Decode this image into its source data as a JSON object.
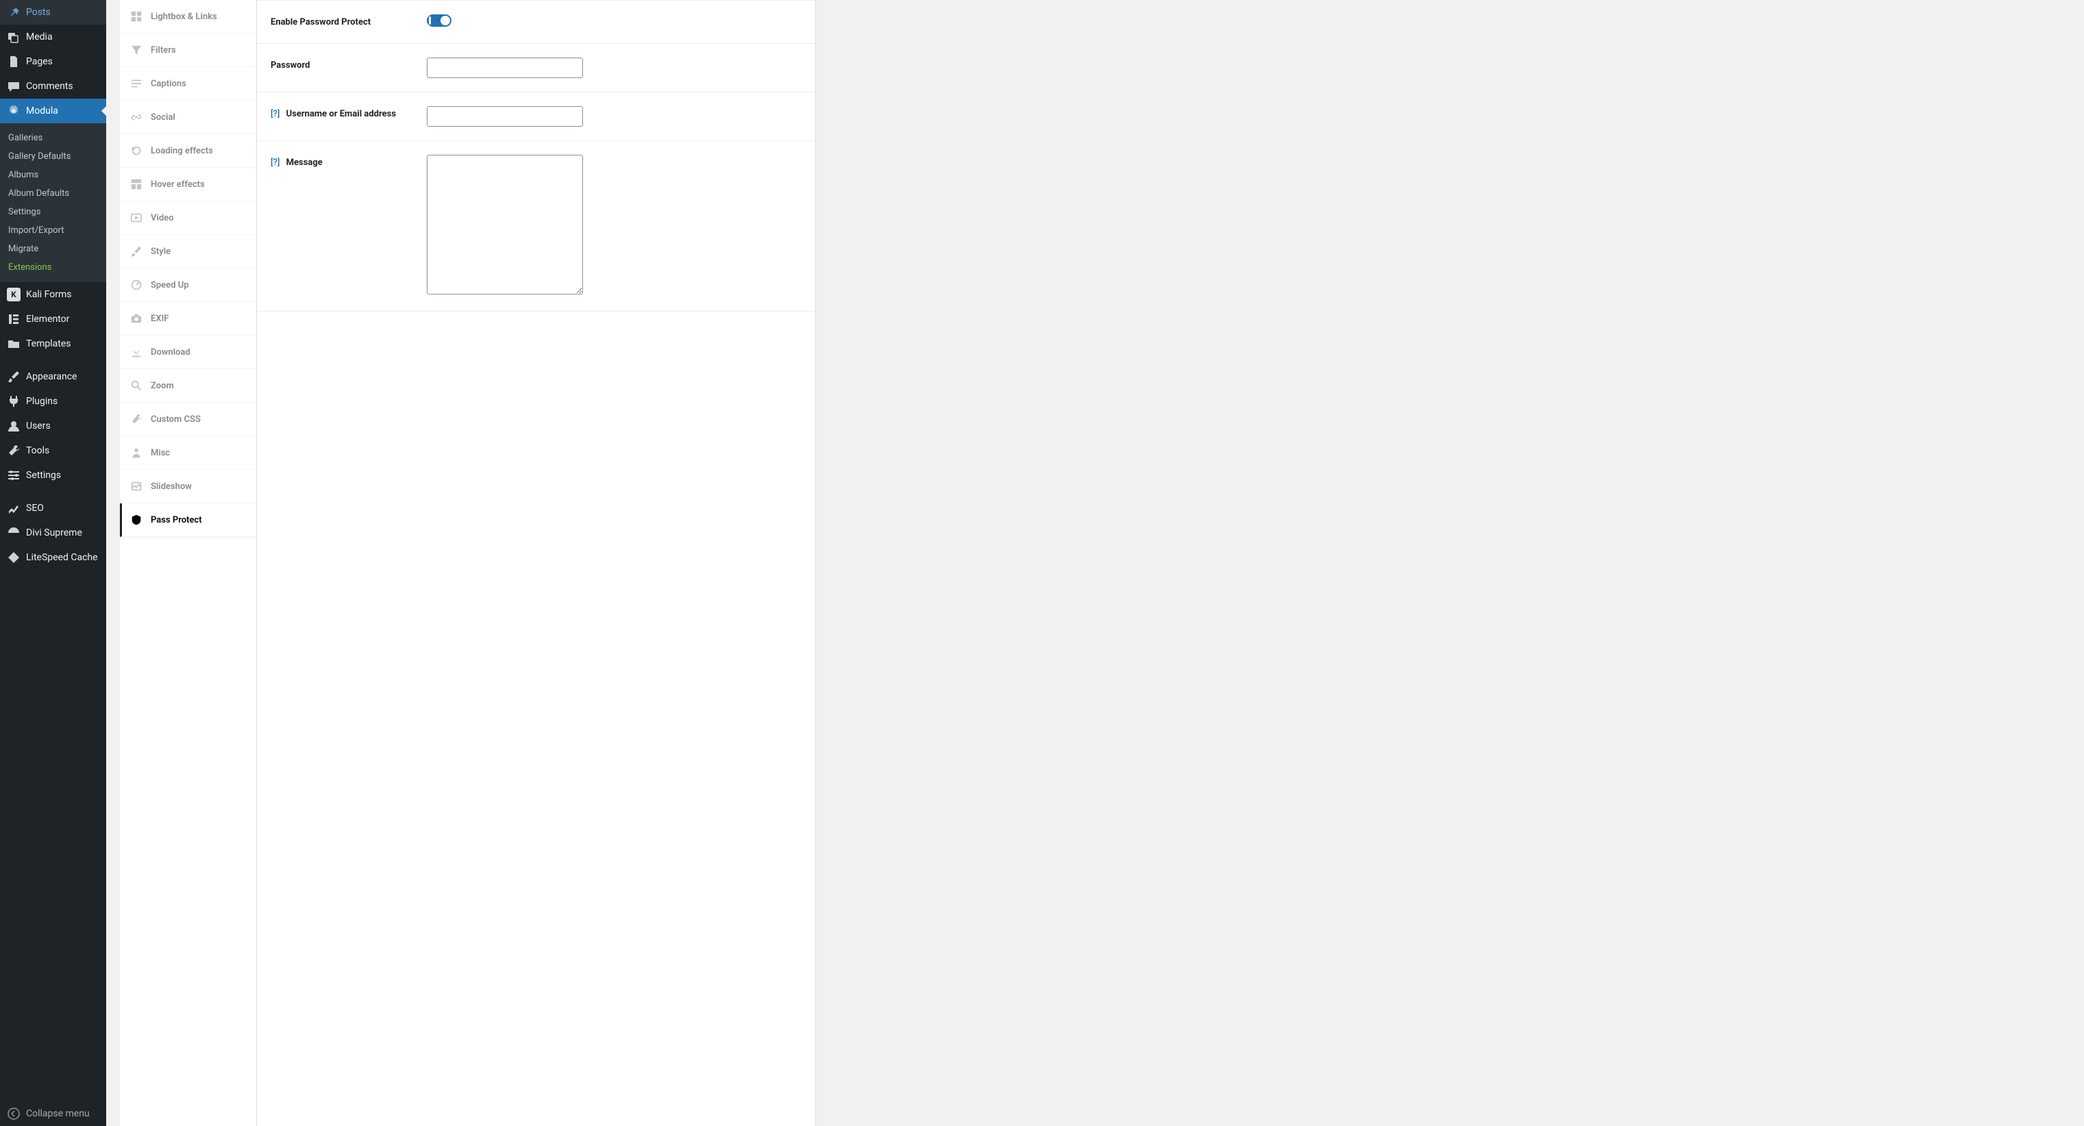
{
  "admin": {
    "items": [
      {
        "label": "Posts"
      },
      {
        "label": "Media"
      },
      {
        "label": "Pages"
      },
      {
        "label": "Comments"
      },
      {
        "label": "Modula"
      }
    ],
    "sub": [
      {
        "label": "Galleries"
      },
      {
        "label": "Gallery Defaults"
      },
      {
        "label": "Albums"
      },
      {
        "label": "Album Defaults"
      },
      {
        "label": "Settings"
      },
      {
        "label": "Import/Export"
      },
      {
        "label": "Migrate"
      },
      {
        "label": "Extensions"
      }
    ],
    "items2": [
      {
        "label": "Kali Forms"
      },
      {
        "label": "Elementor"
      },
      {
        "label": "Templates"
      },
      {
        "label": "Appearance"
      },
      {
        "label": "Plugins"
      },
      {
        "label": "Users"
      },
      {
        "label": "Tools"
      },
      {
        "label": "Settings"
      },
      {
        "label": "SEO"
      },
      {
        "label": "Divi Supreme"
      },
      {
        "label": "LiteSpeed Cache"
      }
    ],
    "collapse": "Collapse menu"
  },
  "tabs": [
    {
      "label": "Lightbox & Links"
    },
    {
      "label": "Filters"
    },
    {
      "label": "Captions"
    },
    {
      "label": "Social"
    },
    {
      "label": "Loading effects"
    },
    {
      "label": "Hover effects"
    },
    {
      "label": "Video"
    },
    {
      "label": "Style"
    },
    {
      "label": "Speed Up"
    },
    {
      "label": "EXIF"
    },
    {
      "label": "Download"
    },
    {
      "label": "Zoom"
    },
    {
      "label": "Custom CSS"
    },
    {
      "label": "Misc"
    },
    {
      "label": "Slideshow"
    },
    {
      "label": "Pass Protect"
    }
  ],
  "form": {
    "enable_label": "Enable Password Protect",
    "password_label": "Password",
    "username_label": "Username or Email address",
    "message_label": "Message",
    "help": "[?]",
    "password_value": "",
    "username_value": "",
    "message_value": ""
  }
}
